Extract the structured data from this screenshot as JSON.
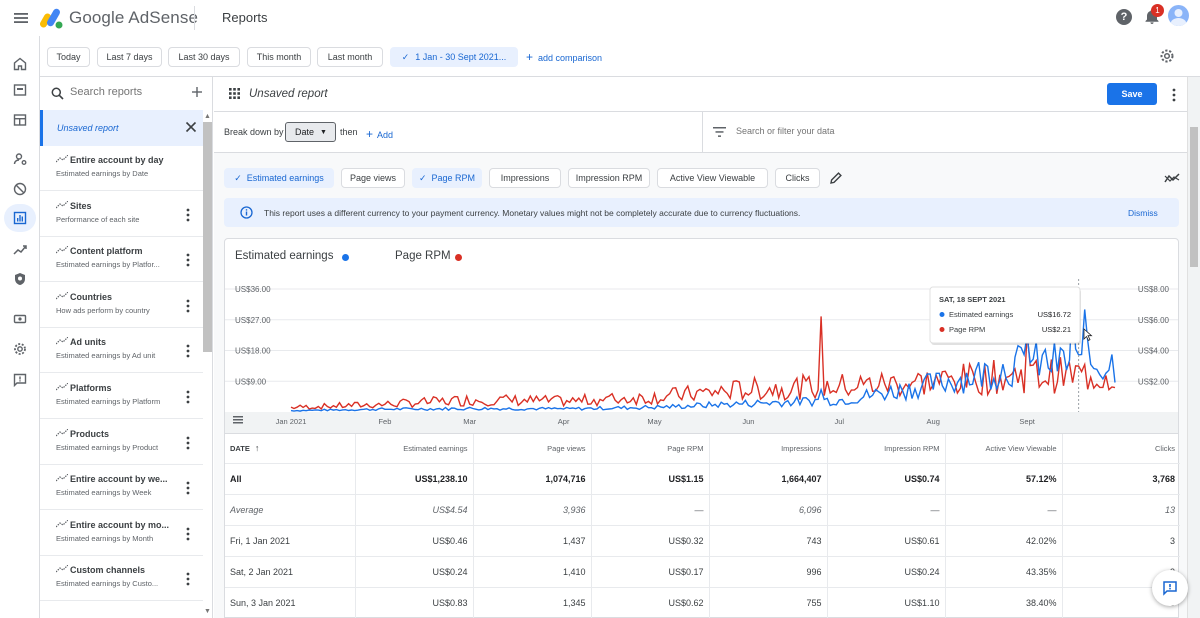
{
  "header": {
    "brand": "Google AdSense",
    "page_title": "Reports",
    "notification_count": "1"
  },
  "date_filters": {
    "chips": [
      "Today",
      "Last 7 days",
      "Last 30 days",
      "This month",
      "Last month"
    ],
    "selected_range": "1 Jan - 30 Sept 2021...",
    "add_comparison": "add comparison"
  },
  "reports_panel": {
    "search_placeholder": "Search reports",
    "active_report": "Unsaved report",
    "items": [
      {
        "title": "Entire account by day",
        "subtitle": "Estimated earnings by Date"
      },
      {
        "title": "Sites",
        "subtitle": "Performance of each site"
      },
      {
        "title": "Content platform",
        "subtitle": "Estimated earnings by Platfor..."
      },
      {
        "title": "Countries",
        "subtitle": "How ads perform by country"
      },
      {
        "title": "Ad units",
        "subtitle": "Estimated earnings by Ad unit"
      },
      {
        "title": "Platforms",
        "subtitle": "Estimated earnings by Platform"
      },
      {
        "title": "Products",
        "subtitle": "Estimated earnings by Product"
      },
      {
        "title": "Entire account by we...",
        "subtitle": "Estimated earnings by Week"
      },
      {
        "title": "Entire account by mo...",
        "subtitle": "Estimated earnings by Month"
      },
      {
        "title": "Custom channels",
        "subtitle": "Estimated earnings by Custo..."
      }
    ]
  },
  "report": {
    "title": "Unsaved report",
    "save_label": "Save",
    "breakdown_label": "Break down by",
    "breakdown_value": "Date",
    "then_label": "then",
    "add_label": "Add",
    "filter_placeholder": "Search or filter your data"
  },
  "metric_chips": [
    {
      "label": "Estimated earnings",
      "selected": true
    },
    {
      "label": "Page views",
      "selected": false
    },
    {
      "label": "Page RPM",
      "selected": true
    },
    {
      "label": "Impressions",
      "selected": false
    },
    {
      "label": "Impression RPM",
      "selected": false
    },
    {
      "label": "Active View Viewable",
      "selected": false
    },
    {
      "label": "Clicks",
      "selected": false
    }
  ],
  "banner": {
    "text": "This report uses a different currency to your payment currency. Monetary values might not be completely accurate due to currency fluctuations.",
    "dismiss": "Dismiss"
  },
  "colors": {
    "earnings": "#1a73e8",
    "rpm": "#d93025",
    "accent": "#1a73e8"
  },
  "chart_data": {
    "type": "line",
    "series": [
      {
        "name": "Estimated earnings",
        "axis": "left"
      },
      {
        "name": "Page RPM",
        "axis": "right"
      }
    ],
    "y_left_ticks": [
      "US$9.00",
      "US$18.00",
      "US$27.00",
      "US$36.00"
    ],
    "y_left_lim": [
      0,
      36
    ],
    "y_right_ticks": [
      "US$2.00",
      "US$4.00",
      "US$6.00",
      "US$8.00"
    ],
    "y_right_lim": [
      0,
      8
    ],
    "x_ticks": [
      "Jan 2021",
      "Feb",
      "Mar",
      "Apr",
      "May",
      "Jun",
      "Jul",
      "Aug",
      "Sept"
    ],
    "earnings_monthly_level": [
      0.4,
      0.8,
      1.0,
      0.9,
      1.4,
      2.5,
      3.5,
      8.0,
      14.0
    ],
    "rpm_monthly_level": [
      0.3,
      0.5,
      0.8,
      0.7,
      1.0,
      1.5,
      1.7,
      2.0,
      2.4
    ],
    "tooltip": {
      "date": "SAT, 18 SEPT 2021",
      "rows": [
        {
          "label": "Estimated earnings",
          "value": "US$16.72"
        },
        {
          "label": "Page RPM",
          "value": "US$2.21"
        }
      ]
    }
  },
  "table": {
    "columns": [
      "DATE",
      "Estimated earnings",
      "Page views",
      "Page RPM",
      "Impressions",
      "Impression RPM",
      "Active View Viewable",
      "Clicks"
    ],
    "total": [
      "All",
      "US$1,238.10",
      "1,074,716",
      "US$1.15",
      "1,664,407",
      "US$0.74",
      "57.12%",
      "3,768"
    ],
    "average": [
      "Average",
      "US$4.54",
      "3,936",
      "—",
      "6,096",
      "—",
      "—",
      "13"
    ],
    "rows": [
      [
        "Fri, 1 Jan 2021",
        "US$0.46",
        "1,437",
        "US$0.32",
        "743",
        "US$0.61",
        "42.02%",
        "3"
      ],
      [
        "Sat, 2 Jan 2021",
        "US$0.24",
        "1,410",
        "US$0.17",
        "996",
        "US$0.24",
        "43.35%",
        "3"
      ],
      [
        "Sun, 3 Jan 2021",
        "US$0.83",
        "1,345",
        "US$0.62",
        "755",
        "US$1.10",
        "38.40%",
        "5"
      ]
    ]
  }
}
